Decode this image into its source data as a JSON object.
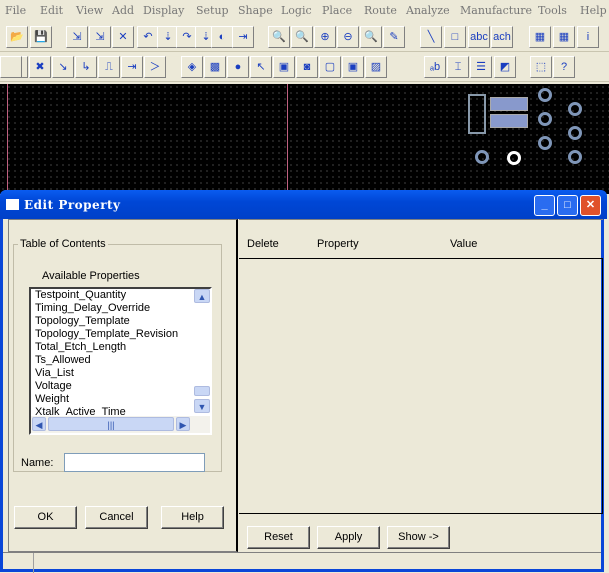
{
  "menu": [
    "File",
    "Edit",
    "View",
    "Add",
    "Display",
    "Setup",
    "Shape",
    "Logic",
    "Place",
    "Route",
    "Analyze",
    "Manufacture",
    "Tools",
    "Help"
  ],
  "toolbar1": [
    "open-icon",
    "save-icon",
    "move-icon",
    "copy-icon",
    "delete-icon",
    "undo-icon",
    "undo-arrow-icon",
    "redo-icon",
    "redo-arrow-icon",
    "spin-icon",
    "connect-icon",
    "zoom-fit-icon",
    "zoom-in-icon",
    "zoom-plus-icon",
    "zoom-minus-icon",
    "zoom-world-icon",
    "color-icon",
    "line-icon",
    "rectangle-icon",
    "text-icon",
    "text-edit-icon",
    "layers-icon",
    "color-grid-icon",
    "info-icon"
  ],
  "toolbar2": [
    "add-connect-icon",
    "add-connect-green-icon",
    "slide-icon",
    "vertex-icon",
    "delay-tune-icon",
    "via-icon",
    "custom-smooth-icon",
    "shape-add-icon",
    "shape-fill-icon",
    "circle-shape-icon",
    "select-icon",
    "shape-void-icon",
    "void-circle-icon",
    "void-rect-icon",
    "shape-edit-icon",
    "island-icon",
    "merge-icon",
    "dimension-icon",
    "pin-icon",
    "property-icon",
    "camera-icon",
    "grid-icon",
    "help-icon"
  ],
  "toolbar_glyphs": {
    "toolbar1": [
      "📂",
      "💾",
      "⇲",
      "⇲",
      "✕",
      "↶",
      "⇣",
      "↷",
      "⇣",
      "◐",
      "⇥",
      "🔍",
      "🔍",
      "⊕",
      "⊖",
      "🔍",
      "✎",
      "╲",
      "□",
      "abc",
      "ach",
      "▦",
      "▦",
      "i"
    ],
    "toolbar2": [
      "✖",
      "✖",
      "↘",
      "↳",
      "⎍",
      "⇥",
      "＞",
      "◈",
      "▩",
      "●",
      "↖",
      "▣",
      "◙",
      "▢",
      "▣",
      "▨",
      "ₐb",
      "⌶",
      "☰",
      "◩",
      "⬚",
      "?"
    ]
  },
  "dialog": {
    "title": "Edit Property",
    "toc_label": "Table of Contents",
    "available_label": "Available Properties",
    "properties": [
      "Testpoint_Quantity",
      "Timing_Delay_Override",
      "Topology_Template",
      "Topology_Template_Revision",
      "Total_Etch_Length",
      "Ts_Allowed",
      "Via_List",
      "Voltage",
      "Weight",
      "Xtalk_Active_Time"
    ],
    "name_label": "Name:",
    "name_value": "",
    "ok": "OK",
    "cancel": "Cancel",
    "help": "Help",
    "columns": [
      "Delete",
      "Property",
      "Value"
    ],
    "reset": "Reset",
    "apply": "Apply",
    "show": "Show ->",
    "minimize": "_",
    "maximize": "□",
    "close": "✕"
  },
  "colors": {
    "titlebar": "#0047d6",
    "close": "#e0522a",
    "canvas": "#000000"
  }
}
